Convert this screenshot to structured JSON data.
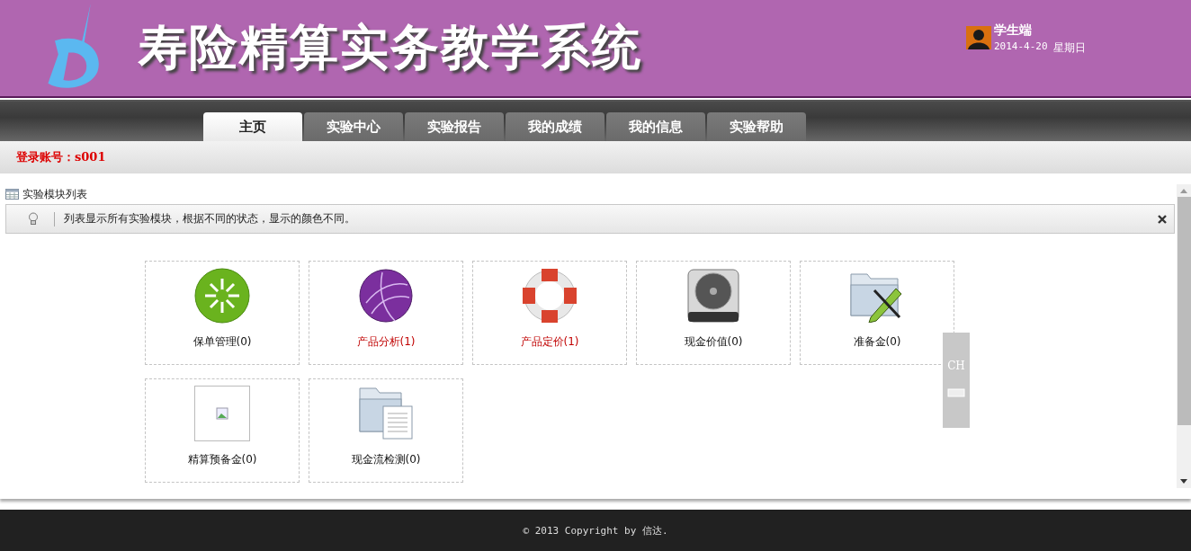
{
  "header": {
    "title": "寿险精算实务教学系统",
    "user": {
      "role": "学生端",
      "date": "2014-4-20",
      "weekday": "星期日"
    }
  },
  "tabs": [
    {
      "label": "主页",
      "selected": true
    },
    {
      "label": "实验中心",
      "selected": false
    },
    {
      "label": "实验报告",
      "selected": false
    },
    {
      "label": "我的成绩",
      "selected": false
    },
    {
      "label": "我的信息",
      "selected": false
    },
    {
      "label": "实验帮助",
      "selected": false
    }
  ],
  "login_bar": {
    "text": "登录账号：s001"
  },
  "panel": {
    "title": "实验模块列表",
    "notice": "列表显示所有实验模块，根据不同的状态，显示的颜色不同。"
  },
  "modules": [
    {
      "label": "保单管理(0)",
      "highlighted": false
    },
    {
      "label": "产品分析(1)",
      "highlighted": true
    },
    {
      "label": "产品定价(1)",
      "highlighted": true
    },
    {
      "label": "现金价值(0)",
      "highlighted": false
    },
    {
      "label": "准备金(0)",
      "highlighted": false
    },
    {
      "label": "精算预备金(0)",
      "highlighted": false
    },
    {
      "label": "现金流检测(0)",
      "highlighted": false
    }
  ],
  "ime_toolbar": {
    "mode": "CH"
  },
  "footer": {
    "copyright": "© 2013 Copyright by 信达."
  }
}
